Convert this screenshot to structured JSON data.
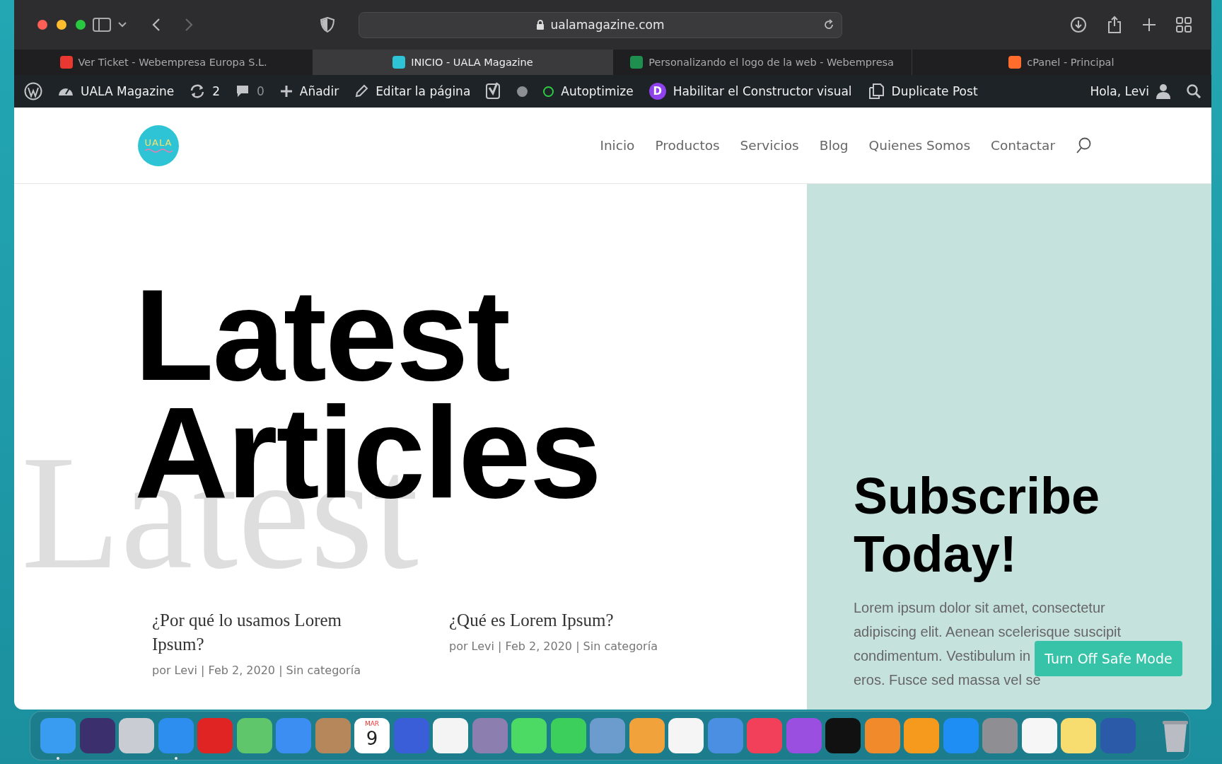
{
  "browser": {
    "address": "ualamagazine.com",
    "tabs": [
      {
        "title": "Ver Ticket - Webempresa Europa S.L.",
        "selected": false,
        "color": "#e8382f"
      },
      {
        "title": "INICIO - UALA Magazine",
        "selected": true,
        "color": "#2ec4d6"
      },
      {
        "title": "Personalizando el logo de la web - Webempresa",
        "selected": false,
        "color": "#1e8f4e"
      },
      {
        "title": "cPanel - Principal",
        "selected": false,
        "color": "#ff6c2c"
      }
    ]
  },
  "admin_bar": {
    "site": "UALA Magazine",
    "updates": "2",
    "comments": "0",
    "add": "Añadir",
    "edit": "Editar la página",
    "autoptimize": "Autoptimize",
    "divi_letter": "D",
    "builder": "Habilitar el Constructor visual",
    "duplicate": "Duplicate Post",
    "greeting": "Hola, Levi"
  },
  "header": {
    "logo_text": "UALA",
    "nav": [
      {
        "label": "Inicio"
      },
      {
        "label": "Productos"
      },
      {
        "label": "Servicios"
      },
      {
        "label": "Blog"
      },
      {
        "label": "Quienes Somos"
      },
      {
        "label": "Contactar"
      }
    ]
  },
  "hero": {
    "background_text": "Latest",
    "title_lines": [
      "Latest",
      "Articles"
    ],
    "posts": [
      {
        "title": "¿Por qué lo usamos Lorem Ipsum?",
        "meta": "por Levi | Feb 2, 2020 | Sin categoría"
      },
      {
        "title": "¿Qué es Lorem Ipsum?",
        "meta": "por Levi | Feb 2, 2020 | Sin categoría"
      }
    ]
  },
  "subscribe": {
    "title_lines": [
      "Subscribe",
      "Today!"
    ],
    "text_lines": [
      "Lorem ipsum dolor sit amet, consectetur",
      "adipiscing elit. Aenean scelerisque suscipit",
      "condimentum. Vestibulum in",
      "eros. Fusce sed massa vel se"
    ]
  },
  "safe_mode_button": "Turn Off Safe Mode",
  "dock": [
    {
      "kind": "app",
      "color": "#3a9cf0",
      "running": true
    },
    {
      "kind": "app",
      "color": "#3b2f6e",
      "running": false
    },
    {
      "kind": "app",
      "color": "#c9ccd3",
      "running": false
    },
    {
      "kind": "app",
      "color": "#2d8ef0",
      "running": true
    },
    {
      "kind": "app",
      "color": "#e02424",
      "running": false
    },
    {
      "kind": "app",
      "color": "#5fc66b",
      "running": false
    },
    {
      "kind": "app",
      "color": "#3d8ef2",
      "running": false
    },
    {
      "kind": "app",
      "color": "#b5875a",
      "running": false
    },
    {
      "kind": "calendar",
      "color": "#ffffff",
      "running": false,
      "month": "MAR",
      "day": "9"
    },
    {
      "kind": "app",
      "color": "#3a5ed8",
      "running": false
    },
    {
      "kind": "app",
      "color": "#f4f4f4",
      "running": false
    },
    {
      "kind": "app",
      "color": "#8c7fb0",
      "running": false
    },
    {
      "kind": "app",
      "color": "#4cd964",
      "running": false
    },
    {
      "kind": "app",
      "color": "#3ccf5b",
      "running": false
    },
    {
      "kind": "app",
      "color": "#6b9ccd",
      "running": false
    },
    {
      "kind": "app",
      "color": "#f1a23a",
      "running": false
    },
    {
      "kind": "app",
      "color": "#f5f5f5",
      "running": false
    },
    {
      "kind": "app",
      "color": "#4b8fe3",
      "running": false
    },
    {
      "kind": "app",
      "color": "#f2405a",
      "running": false
    },
    {
      "kind": "app",
      "color": "#9b4fe0",
      "running": false
    },
    {
      "kind": "app",
      "color": "#111111",
      "running": false
    },
    {
      "kind": "app",
      "color": "#f08a2a",
      "running": false
    },
    {
      "kind": "app",
      "color": "#f59a1c",
      "running": false
    },
    {
      "kind": "app",
      "color": "#1e8ef5",
      "running": false
    },
    {
      "kind": "app",
      "color": "#8e8e93",
      "running": false
    },
    {
      "kind": "app",
      "color": "#f6f6f6",
      "running": false
    },
    {
      "kind": "app",
      "color": "#f7dc6f",
      "running": false
    },
    {
      "kind": "app",
      "color": "#2b5aa8",
      "running": false
    },
    {
      "kind": "trash",
      "color": "#b9bcc2",
      "running": false
    }
  ]
}
